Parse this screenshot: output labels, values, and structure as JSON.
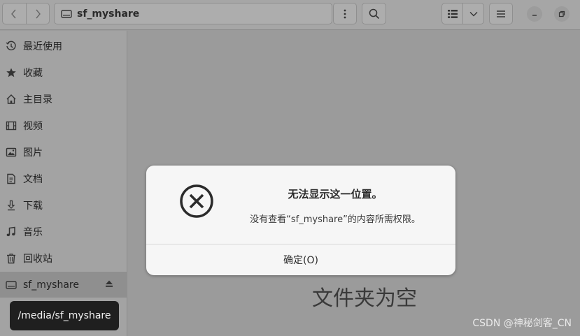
{
  "header": {
    "location_title": "sf_myshare",
    "back_icon": "chevron-left-icon",
    "forward_icon": "chevron-right-icon",
    "menu_icon": "vertical-dots-icon",
    "search_icon": "search-icon",
    "view_icon": "list-view-icon",
    "view_options_icon": "chevron-down-icon",
    "hamburger_icon": "hamburger-menu-icon",
    "minimize_icon": "minimize-icon",
    "restore_icon": "restore-icon"
  },
  "sidebar": {
    "items": [
      {
        "label": "最近使用",
        "icon": "clock-icon"
      },
      {
        "label": "收藏",
        "icon": "star-icon"
      },
      {
        "label": "主目录",
        "icon": "home-icon"
      },
      {
        "label": "视频",
        "icon": "film-icon"
      },
      {
        "label": "图片",
        "icon": "image-icon"
      },
      {
        "label": "文档",
        "icon": "document-icon"
      },
      {
        "label": "下载",
        "icon": "download-icon"
      },
      {
        "label": "音乐",
        "icon": "music-icon"
      },
      {
        "label": "回收站",
        "icon": "trash-icon"
      },
      {
        "label": "sf_myshare",
        "icon": "drive-icon"
      }
    ],
    "eject_icon": "eject-icon"
  },
  "main": {
    "empty_label": "文件夹为空"
  },
  "dialog": {
    "title": "无法显示这一位置。",
    "message": "没有查看“sf_myshare”的内容所需权限。",
    "ok_button": "确定(O)",
    "icon": "error-circle-x-icon"
  },
  "tooltip": {
    "text": "/media/sf_myshare"
  },
  "watermark": "CSDN @神秘剑客_CN"
}
